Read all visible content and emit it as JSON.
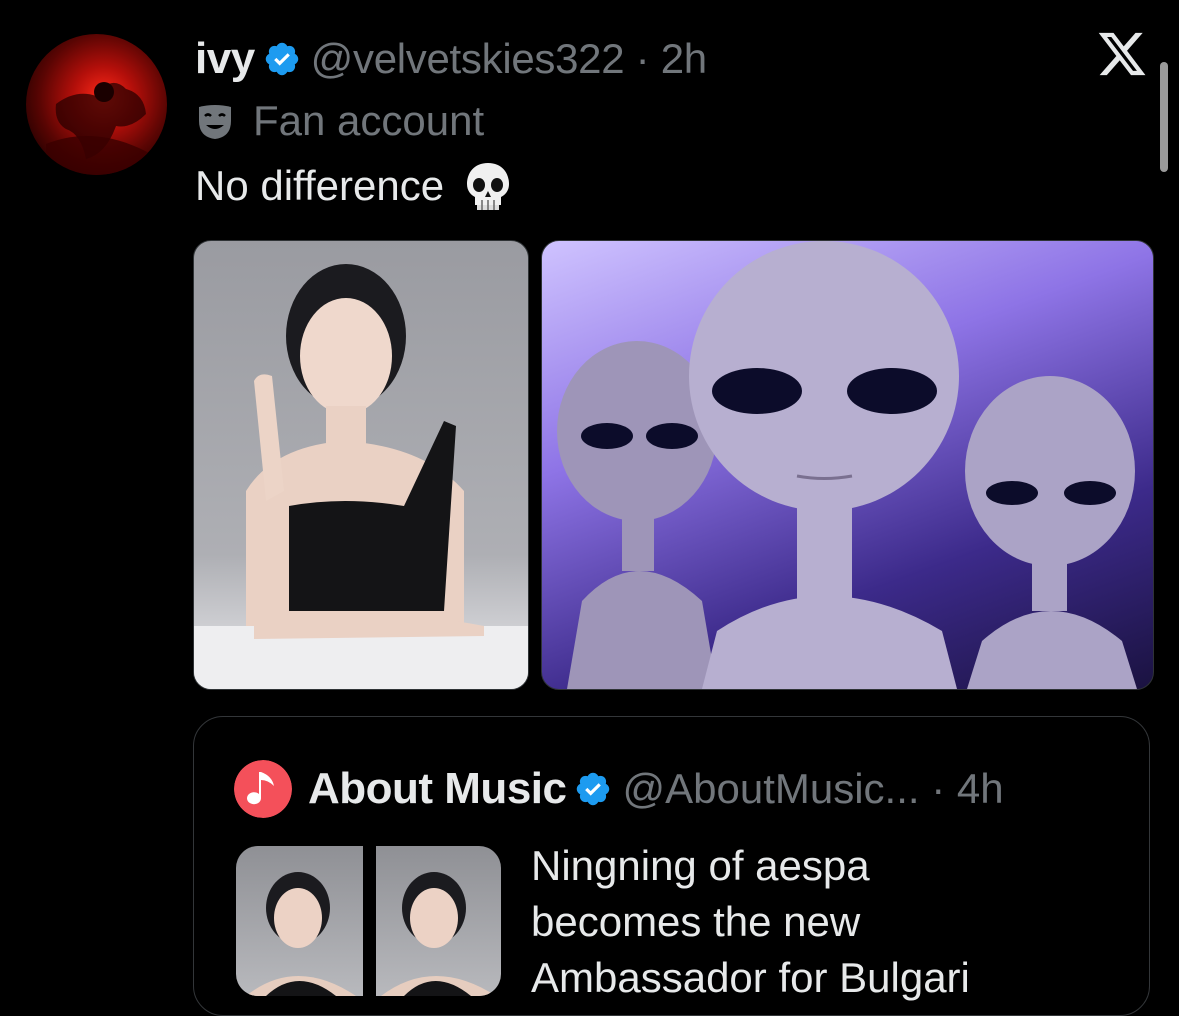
{
  "author": {
    "name": "ivy",
    "handle_time": "@velvetskies322 · 2h",
    "label": "Fan account",
    "avatar_icon": "profile-photo-red",
    "verified_color": "#1d9bf0"
  },
  "tweet": {
    "text": "No difference",
    "emoji_icon": "skull-icon"
  },
  "media": [
    {
      "alt": "portrait-photo",
      "icon": "portrait-image"
    },
    {
      "alt": "aliens-photo",
      "icon": "aliens-image"
    }
  ],
  "quote": {
    "name": "About Music",
    "handle_time": "@AboutMusic... · 4h",
    "text_line1": "Ningning of aespa",
    "text_line2": "becomes the new",
    "text_line3": "Ambassador for Bulgari",
    "avatar_color": "#f4505a"
  },
  "brand": {
    "logo_icon": "x-logo-icon"
  },
  "colors": {
    "background": "#000000",
    "primary_text": "#e7e9ea",
    "secondary_text": "#71767b",
    "border": "#2f3336"
  }
}
